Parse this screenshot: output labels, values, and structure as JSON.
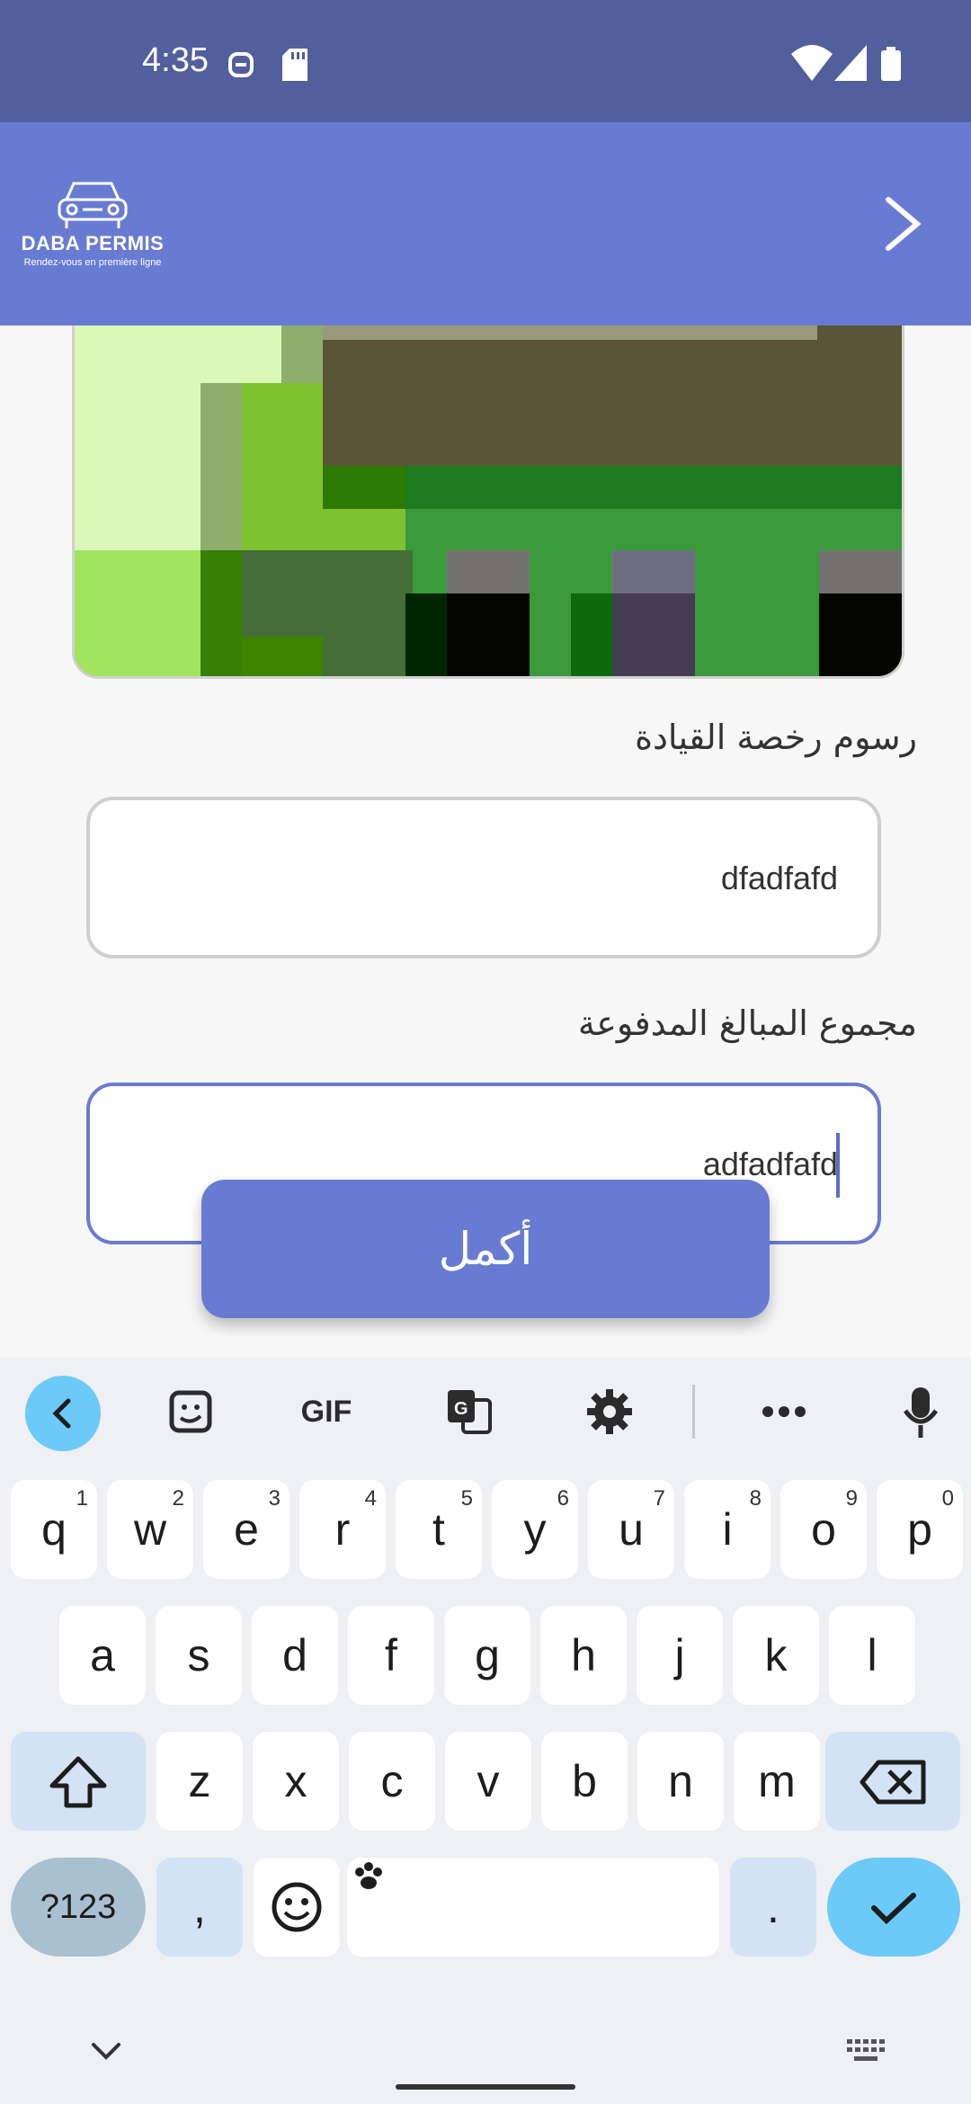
{
  "status_bar": {
    "time": "4:35"
  },
  "header": {
    "logo_title": "DABA PERMIS",
    "logo_tagline": "Rendez-vous en première ligne",
    "next_icon": "chevron-right-icon"
  },
  "form": {
    "license_fee_label": "رسوم رخصة القيادة",
    "license_fee_value": "dfadfafd",
    "total_paid_label": "مجموع المبالغ المدفوعة",
    "total_paid_value": "adfadfafd",
    "complete_label": "أكمل"
  },
  "keyboard": {
    "toolbar": [
      "back-icon",
      "sticker-icon",
      "gif-icon",
      "translate-icon",
      "settings-icon",
      "more-icon",
      "mic-icon"
    ],
    "gif_label": "GIF",
    "row1": [
      {
        "k": "q",
        "h": "1"
      },
      {
        "k": "w",
        "h": "2"
      },
      {
        "k": "e",
        "h": "3"
      },
      {
        "k": "r",
        "h": "4"
      },
      {
        "k": "t",
        "h": "5"
      },
      {
        "k": "y",
        "h": "6"
      },
      {
        "k": "u",
        "h": "7"
      },
      {
        "k": "i",
        "h": "8"
      },
      {
        "k": "o",
        "h": "9"
      },
      {
        "k": "p",
        "h": "0"
      }
    ],
    "row2": [
      "a",
      "s",
      "d",
      "f",
      "g",
      "h",
      "j",
      "k",
      "l"
    ],
    "row3": [
      "z",
      "x",
      "c",
      "v",
      "b",
      "n",
      "m"
    ],
    "symbols_label": "?123",
    "comma_label": ",",
    "period_label": "."
  },
  "colors": {
    "accent": "#687bd3",
    "status_bar": "#515f9c",
    "keyboard_action": "#6ccaf9"
  }
}
